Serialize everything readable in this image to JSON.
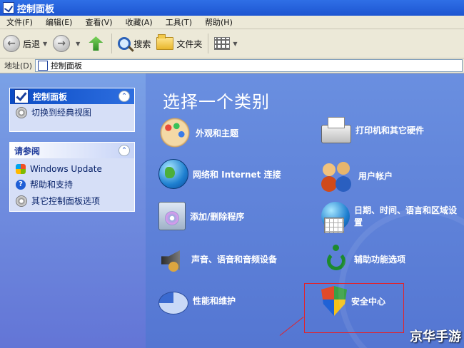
{
  "window": {
    "title": "控制面板"
  },
  "menu": [
    "文件(F)",
    "编辑(E)",
    "查看(V)",
    "收藏(A)",
    "工具(T)",
    "帮助(H)"
  ],
  "toolbar": {
    "back_label": "后退",
    "search_label": "搜索",
    "folders_label": "文件夹"
  },
  "address": {
    "label": "地址(D)",
    "value": "控制面板"
  },
  "sidebar": {
    "panel1": {
      "title": "控制面板",
      "item": "切换到经典视图"
    },
    "panel2": {
      "title": "请参阅",
      "items": [
        "Windows Update",
        "帮助和支持",
        "其它控制面板选项"
      ]
    }
  },
  "main": {
    "heading": "选择一个类别",
    "categories": [
      "外观和主题",
      "网络和 Internet 连接",
      "添加/删除程序",
      "声音、语音和音频设备",
      "性能和维护",
      "打印机和其它硬件",
      "用户帐户",
      "日期、时间、语言和区域设置",
      "辅助功能选项",
      "安全中心"
    ]
  },
  "watermark": "京华手游",
  "colors": {
    "accent": "#5a7edc",
    "highlight": "#e2222a"
  }
}
